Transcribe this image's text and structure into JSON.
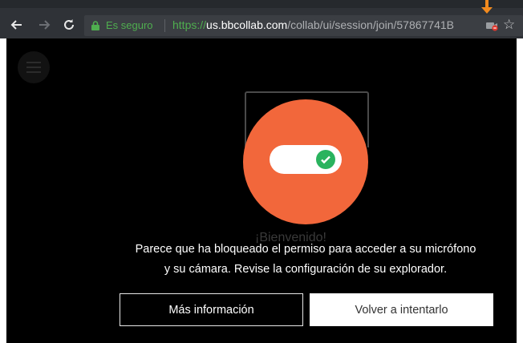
{
  "browser": {
    "secure_label": "Es seguro",
    "url_scheme": "https://",
    "url_host": "us.bbcollab.com",
    "url_path": "/collab/ui/session/join/57867741B",
    "icons": {
      "back": "arrow-left-icon",
      "forward": "arrow-right-icon",
      "reload": "reload-icon",
      "lock": "lock-icon",
      "camera_blocked": "camera-blocked-icon",
      "bookmark": "star-icon",
      "pointer": "orange-arrow-icon"
    }
  },
  "page": {
    "welcome": "¡Bienvenido!",
    "message_line1": "Parece que ha bloqueado el permiso para acceder a su micrófono",
    "message_line2": "y su cámara. Revise la configuración de su explorador.",
    "more_info_label": "Más información",
    "retry_label": "Volver a intentarlo",
    "toggle_state": "on"
  },
  "colors": {
    "accent": "#f2673b",
    "toggle_check": "#2ab35e",
    "secure_green": "#4fae4f",
    "background": "#000000"
  }
}
